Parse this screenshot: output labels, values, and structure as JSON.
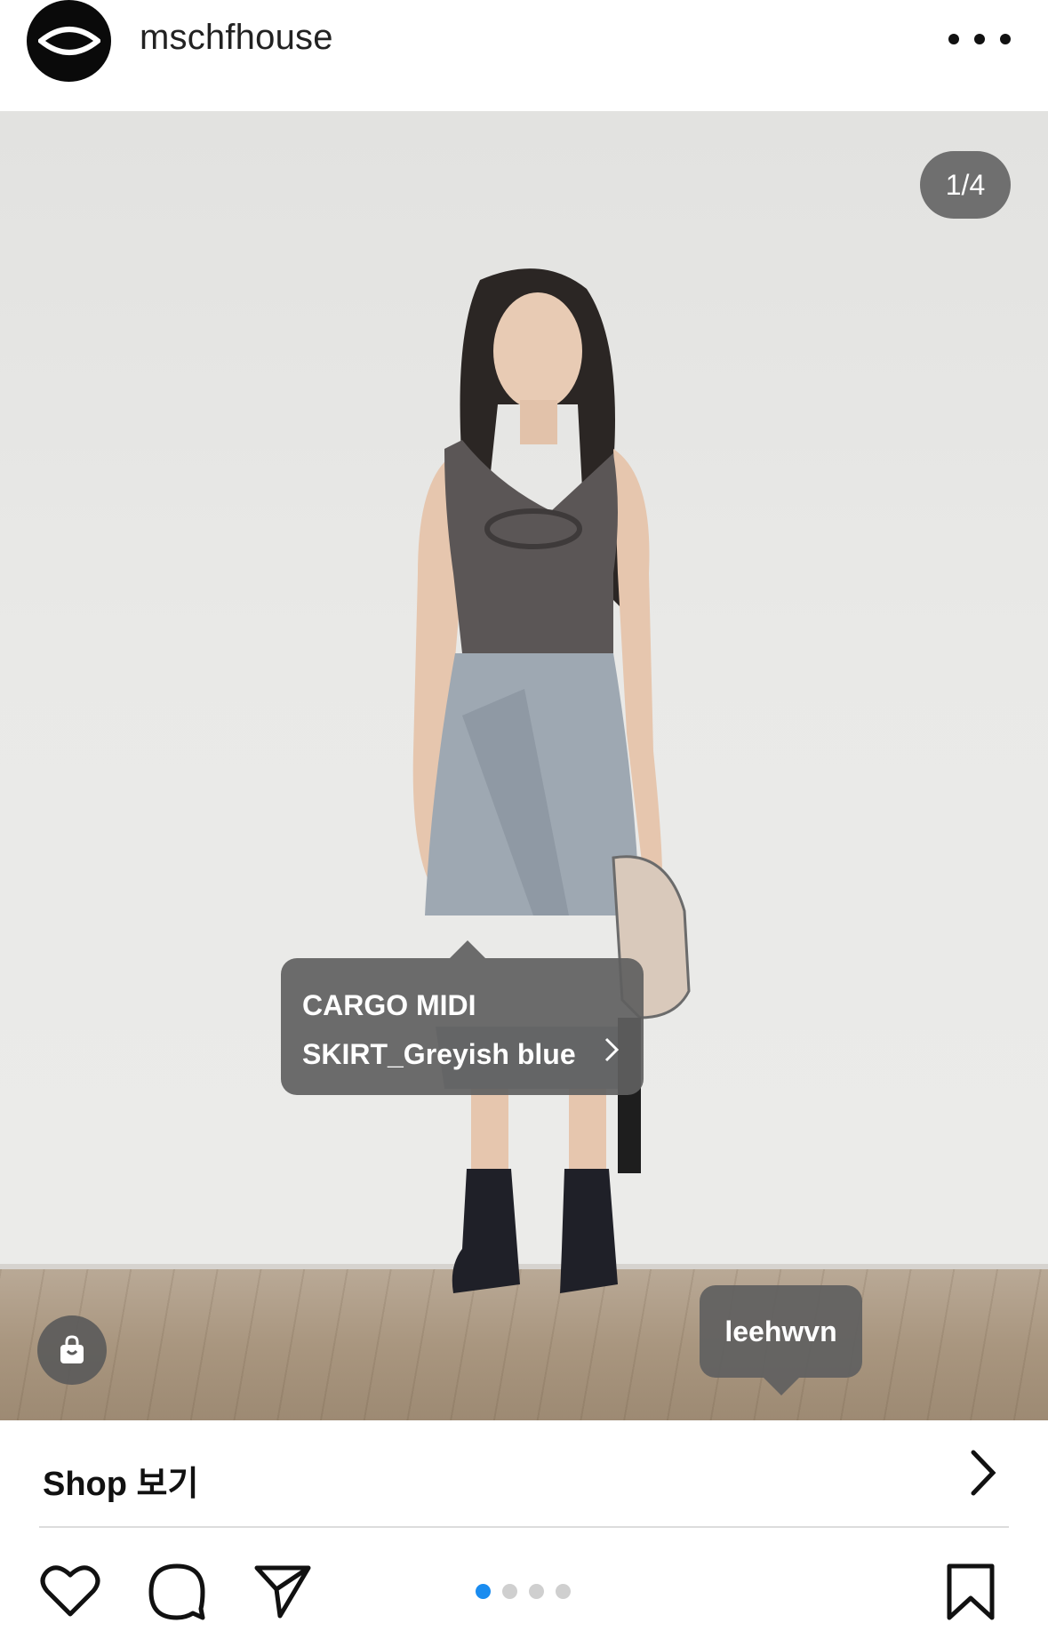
{
  "header": {
    "username": "mschfhouse",
    "avatar_icon": "eye-logo-icon",
    "more_icon": "more-options-icon"
  },
  "post": {
    "counter": "1/4",
    "product_tag": {
      "line1": "CARGO MIDI",
      "line2": "SKIRT_Greyish blue"
    },
    "user_tag": "leehwvn",
    "shop_bubble_icon": "shopping-bag-icon"
  },
  "shop": {
    "label": "Shop 보기",
    "arrow_icon": "chevron-right-icon"
  },
  "actions": {
    "like_icon": "heart-icon",
    "comment_icon": "comment-icon",
    "share_icon": "send-icon",
    "save_icon": "bookmark-icon",
    "carousel": {
      "total": 4,
      "active": 1
    }
  },
  "colors": {
    "carousel_active": "#1a8cf0",
    "carousel_inactive": "#cfcfcf",
    "tag_bg": "#5f5f5f"
  }
}
